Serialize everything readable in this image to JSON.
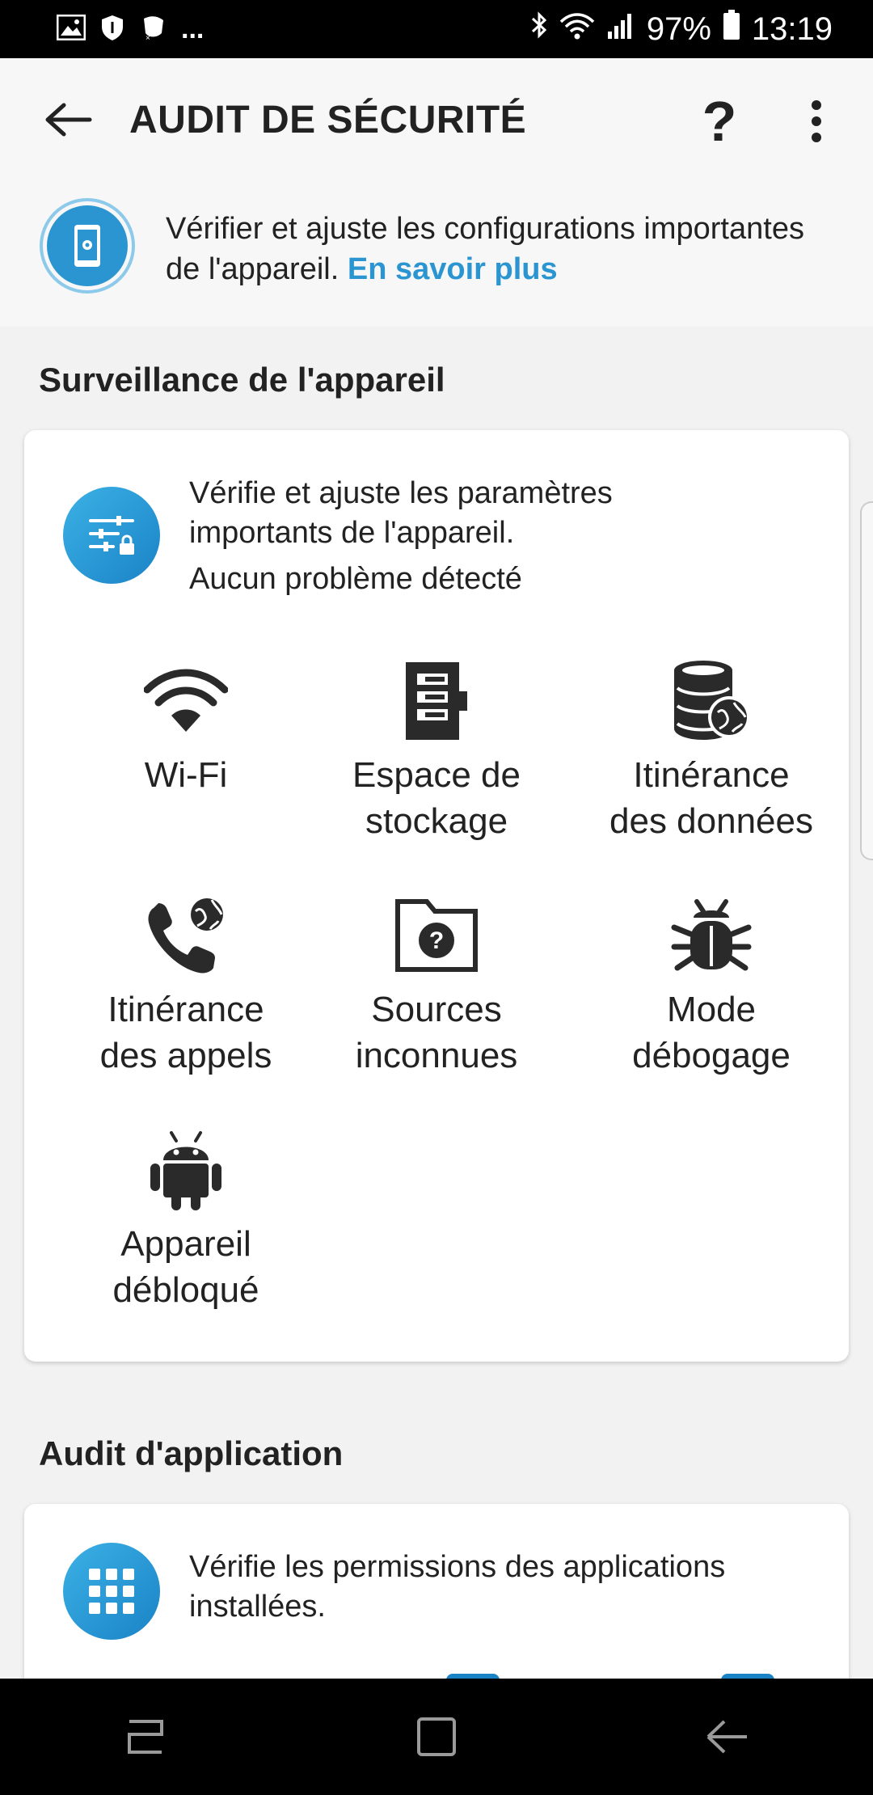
{
  "status_bar": {
    "dots": "...",
    "battery": "97%",
    "time": "13:19"
  },
  "app_bar": {
    "title": "AUDIT DE SÉCURITÉ",
    "help": "?"
  },
  "intro": {
    "text": "Vérifier et ajuste les configurations importantes de l'appareil. ",
    "link": "En savoir plus"
  },
  "device_section": {
    "title": "Surveillance de l'appareil",
    "desc_line1": "Vérifie et ajuste les paramètres",
    "desc_line2": "importants de l'appareil.",
    "status": "Aucun problème détecté",
    "items": [
      {
        "label": "Wi-Fi",
        "icon": "wifi-icon"
      },
      {
        "label": "Espace de\nstockage",
        "icon": "storage-icon"
      },
      {
        "label": "Itinérance\ndes données",
        "icon": "data-roaming-icon"
      },
      {
        "label": "Itinérance\ndes appels",
        "icon": "call-roaming-icon"
      },
      {
        "label": "Sources\ninconnues",
        "icon": "unknown-sources-icon"
      },
      {
        "label": "Mode\ndébogage",
        "icon": "bug-icon"
      },
      {
        "label": "Appareil\ndébloqué",
        "icon": "android-icon"
      }
    ]
  },
  "app_section": {
    "title": "Audit d'application",
    "desc_line1": "Vérifie les permissions des applications",
    "desc_line2": "installées."
  },
  "colors": {
    "accent": "#2b95d1",
    "icon_dark": "#2a2a2a"
  }
}
